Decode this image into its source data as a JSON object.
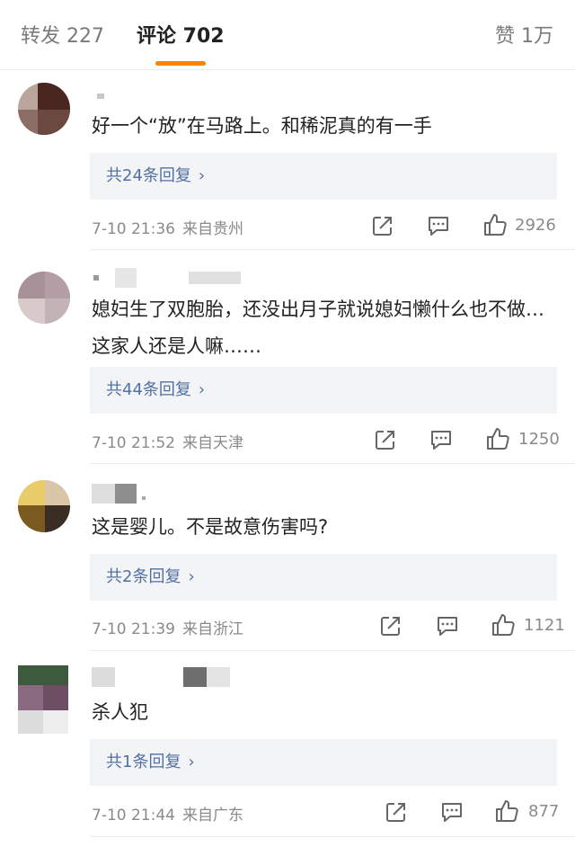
{
  "tabs": {
    "reposts": "转发 227",
    "comments": "评论 702",
    "likes": "赞 1万"
  },
  "comments": [
    {
      "text": "好一个“放”在马路上。和稀泥真的有一手",
      "replies": "共24条回复",
      "time": "7-10 21:36",
      "location": "来自贵州",
      "likes": "2926"
    },
    {
      "text": "媳妇生了双胞胎，还没出月子就说媳妇懒什么也不做…这家人还是人嘛……",
      "replies": "共44条回复",
      "time": "7-10 21:52",
      "location": "来自天津",
      "likes": "1250"
    },
    {
      "text": "这是婴儿。不是故意伤害吗?",
      "replies": "共2条回复",
      "time": "7-10 21:39",
      "location": "来自浙江",
      "likes": "1121"
    },
    {
      "text": "杀人犯",
      "replies": "共1条回复",
      "time": "7-10 21:44",
      "location": "来自广东",
      "likes": "877"
    }
  ],
  "icons": {
    "repost": "share-square-icon",
    "comment": "comment-bubble-icon",
    "like": "thumbs-up-icon",
    "chevron": "chevron-right-icon"
  },
  "colors": {
    "accent": "#ff8200",
    "link": "#5270a3",
    "muted": "#8a8a8a"
  }
}
